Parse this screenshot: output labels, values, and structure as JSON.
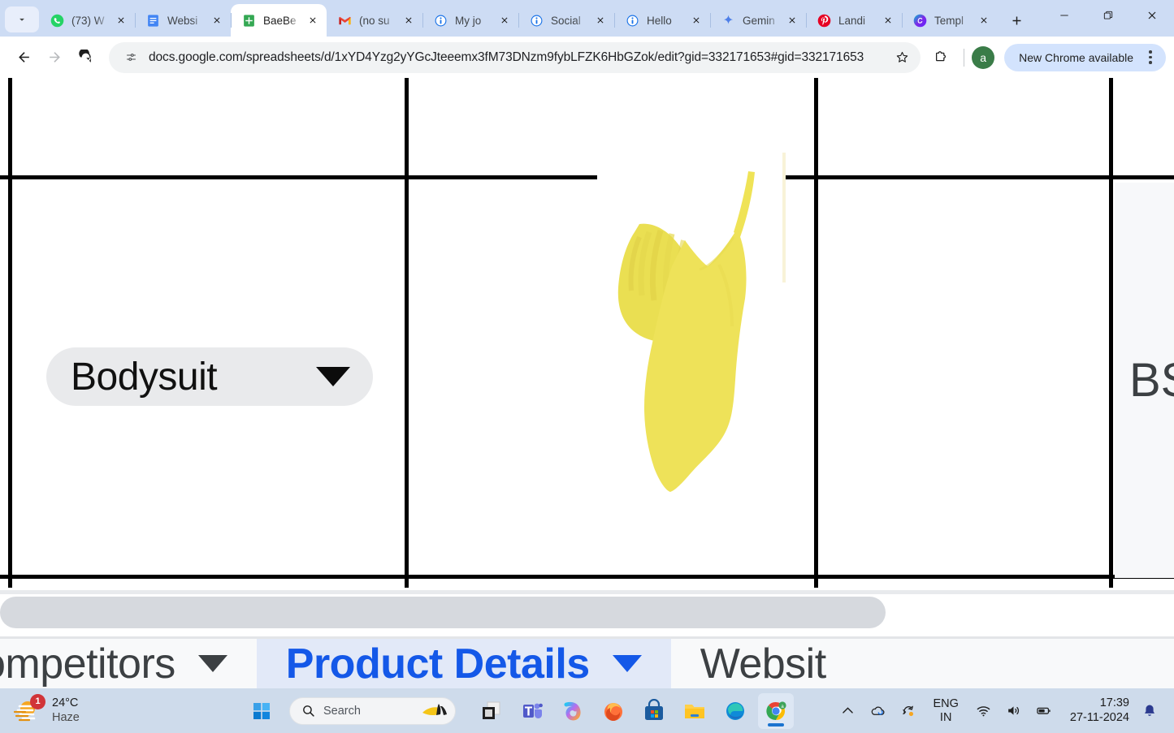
{
  "browser": {
    "tab_search_icon": "chevron-down-icon",
    "new_tab_label": "+",
    "tabs": [
      {
        "title": "(73) W",
        "favicon": "whatsapp-icon",
        "active": false
      },
      {
        "title": "Websi",
        "favicon": "google-docs-icon",
        "active": false
      },
      {
        "title": "BaeBe",
        "favicon": "google-sheets-icon",
        "active": true
      },
      {
        "title": "(no su",
        "favicon": "gmail-icon",
        "active": false
      },
      {
        "title": "My jo",
        "favicon": "info-icon",
        "active": false
      },
      {
        "title": "Social",
        "favicon": "info-icon",
        "active": false
      },
      {
        "title": "Hello",
        "favicon": "info-icon",
        "active": false
      },
      {
        "title": "Gemin",
        "favicon": "gemini-sparkle-icon",
        "active": false
      },
      {
        "title": "Landi",
        "favicon": "pinterest-icon",
        "active": false
      },
      {
        "title": "Templ",
        "favicon": "canva-icon",
        "active": false
      }
    ],
    "window_controls": {
      "minimize": "minimize-icon",
      "maximize": "restore-icon",
      "close": "close-icon"
    },
    "toolbar": {
      "back": "back-arrow-icon",
      "forward": "forward-arrow-icon",
      "reload": "reload-icon",
      "site_info": "site-settings-icon",
      "url": "docs.google.com/spreadsheets/d/1xYD4Yzg2yYGcJteeemx3fM73DNzm9fybLFZK6HbGZok/edit?gid=332171653#gid=332171653",
      "bookmark": "star-icon",
      "extensions": "extensions-puzzle-icon",
      "profile_initial": "a",
      "profile_color": "#3a7c48",
      "update_label": "New Chrome available",
      "update_pill_color": "#d3e3fd",
      "menu": "three-dot-menu-icon"
    }
  },
  "sheet": {
    "dropdown_chip": {
      "value": "Bodysuit",
      "caret": "chevron-down-icon",
      "background": "#e9eaec"
    },
    "product_image_alt": "yellow one-piece swimsuit bodysuit",
    "partial_cell_text": "BS",
    "scrollbar": "horizontal-scrollbar",
    "tabs": [
      {
        "label": "ompetitors",
        "active": false
      },
      {
        "label": "Product Details",
        "active": true
      },
      {
        "label": "Websit",
        "active": false
      }
    ],
    "active_tab_color": "#1458e8",
    "active_tab_background": "#e2e9f8"
  },
  "taskbar": {
    "weather": {
      "temperature": "24°C",
      "condition": "Haze",
      "badge": "1"
    },
    "start": "windows-start-icon",
    "search": {
      "placeholder": "Search",
      "icon": "search-icon"
    },
    "apps": [
      {
        "name": "task-view-icon",
        "active": false
      },
      {
        "name": "microsoft-teams-icon",
        "active": false
      },
      {
        "name": "copilot-icon",
        "active": false
      },
      {
        "name": "firefox-icon",
        "active": false
      },
      {
        "name": "microsoft-store-icon",
        "active": false
      },
      {
        "name": "file-explorer-icon",
        "active": false
      },
      {
        "name": "microsoft-edge-icon",
        "active": false
      },
      {
        "name": "google-chrome-icon",
        "active": true
      }
    ],
    "tray": {
      "overflow": "chevron-up-icon",
      "onedrive": "onedrive-sync-icon",
      "update": "windows-update-icon",
      "language_line1": "ENG",
      "language_line2": "IN",
      "wifi": "wifi-icon",
      "volume": "speaker-icon",
      "battery": "battery-icon",
      "time": "17:39",
      "date": "27-11-2024",
      "notifications": "bell-icon"
    }
  }
}
